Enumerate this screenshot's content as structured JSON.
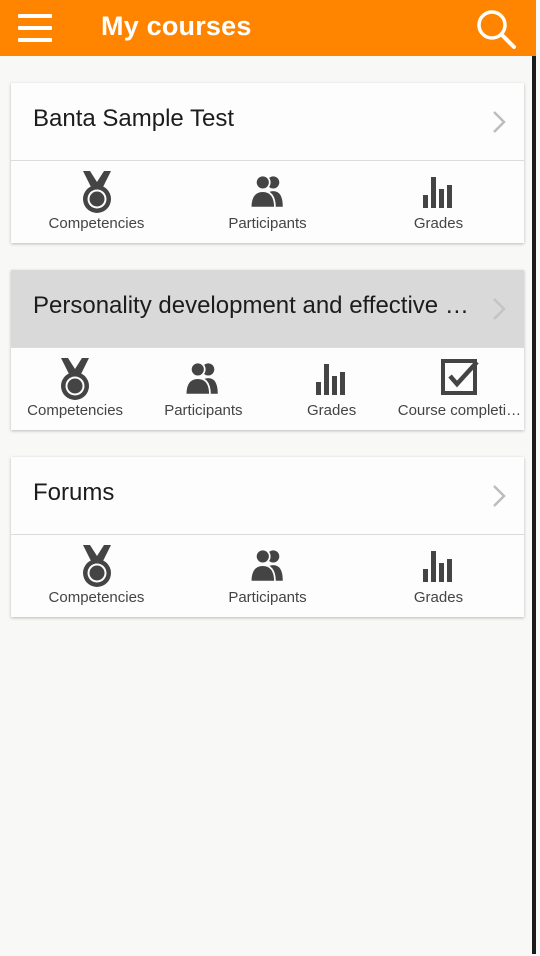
{
  "appbar": {
    "title": "My courses",
    "menu_icon": "hamburger-menu-icon",
    "search_icon": "search-icon",
    "color": "#ff8500"
  },
  "courses": [
    {
      "title": "Banta Sample Test",
      "active": false,
      "actions": [
        {
          "label": "Competencies",
          "icon": "medal-icon"
        },
        {
          "label": "Participants",
          "icon": "participants-icon"
        },
        {
          "label": "Grades",
          "icon": "grades-icon"
        }
      ]
    },
    {
      "title": "Personality development and effective communication",
      "active": true,
      "actions": [
        {
          "label": "Competencies",
          "icon": "medal-icon"
        },
        {
          "label": "Participants",
          "icon": "participants-icon"
        },
        {
          "label": "Grades",
          "icon": "grades-icon"
        },
        {
          "label": "Course completion",
          "icon": "checkbox-icon"
        }
      ]
    },
    {
      "title": "Forums",
      "active": false,
      "actions": [
        {
          "label": "Competencies",
          "icon": "medal-icon"
        },
        {
          "label": "Participants",
          "icon": "participants-icon"
        },
        {
          "label": "Grades",
          "icon": "grades-icon"
        }
      ]
    }
  ]
}
